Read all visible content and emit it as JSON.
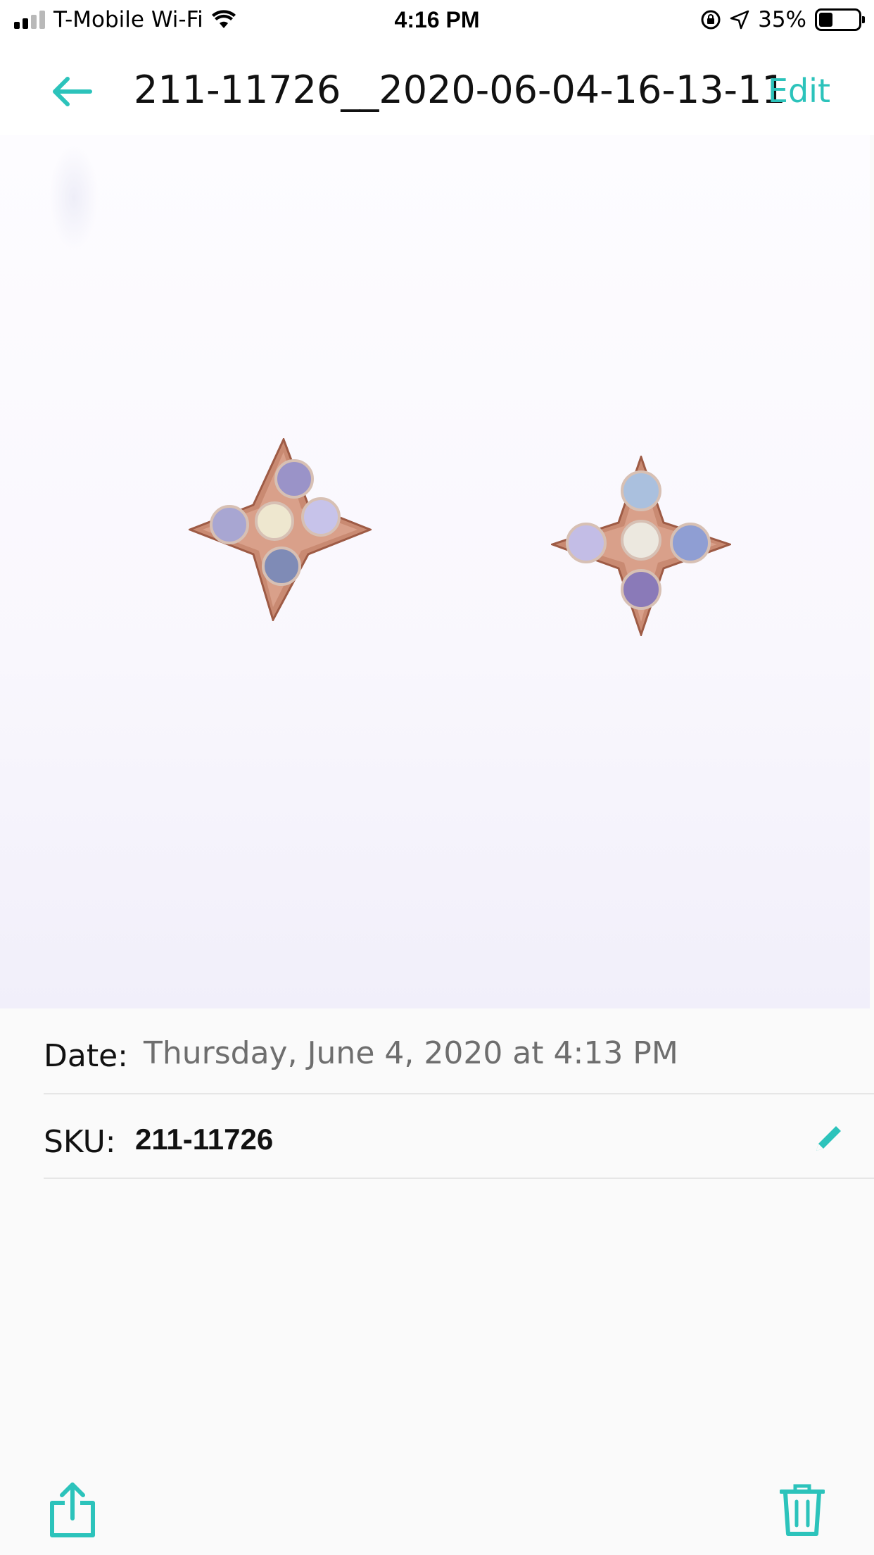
{
  "status_bar": {
    "carrier": "T-Mobile Wi-Fi",
    "time": "4:16 PM",
    "battery": "35%",
    "battery_level": 0.35,
    "icons": [
      "signal-icon",
      "wifi-icon",
      "orientation-lock-icon",
      "location-icon",
      "battery-icon"
    ]
  },
  "nav": {
    "back_icon": "arrow-left-icon",
    "title": "211-11726__2020-06-04-16-13-11",
    "edit_label": "Edit"
  },
  "details": {
    "date_label": "Date:",
    "date_value": "Thursday, June 4, 2020 at 4:13 PM",
    "sku_label": "SKU:",
    "sku_value": "211-11726",
    "edit_icon": "pencil-icon"
  },
  "toolbar": {
    "share_icon": "share-icon",
    "delete_icon": "trash-icon"
  },
  "colors": {
    "accent": "#2cc3bb",
    "date_text": "#6e6e6e",
    "background": "#fafafa"
  }
}
